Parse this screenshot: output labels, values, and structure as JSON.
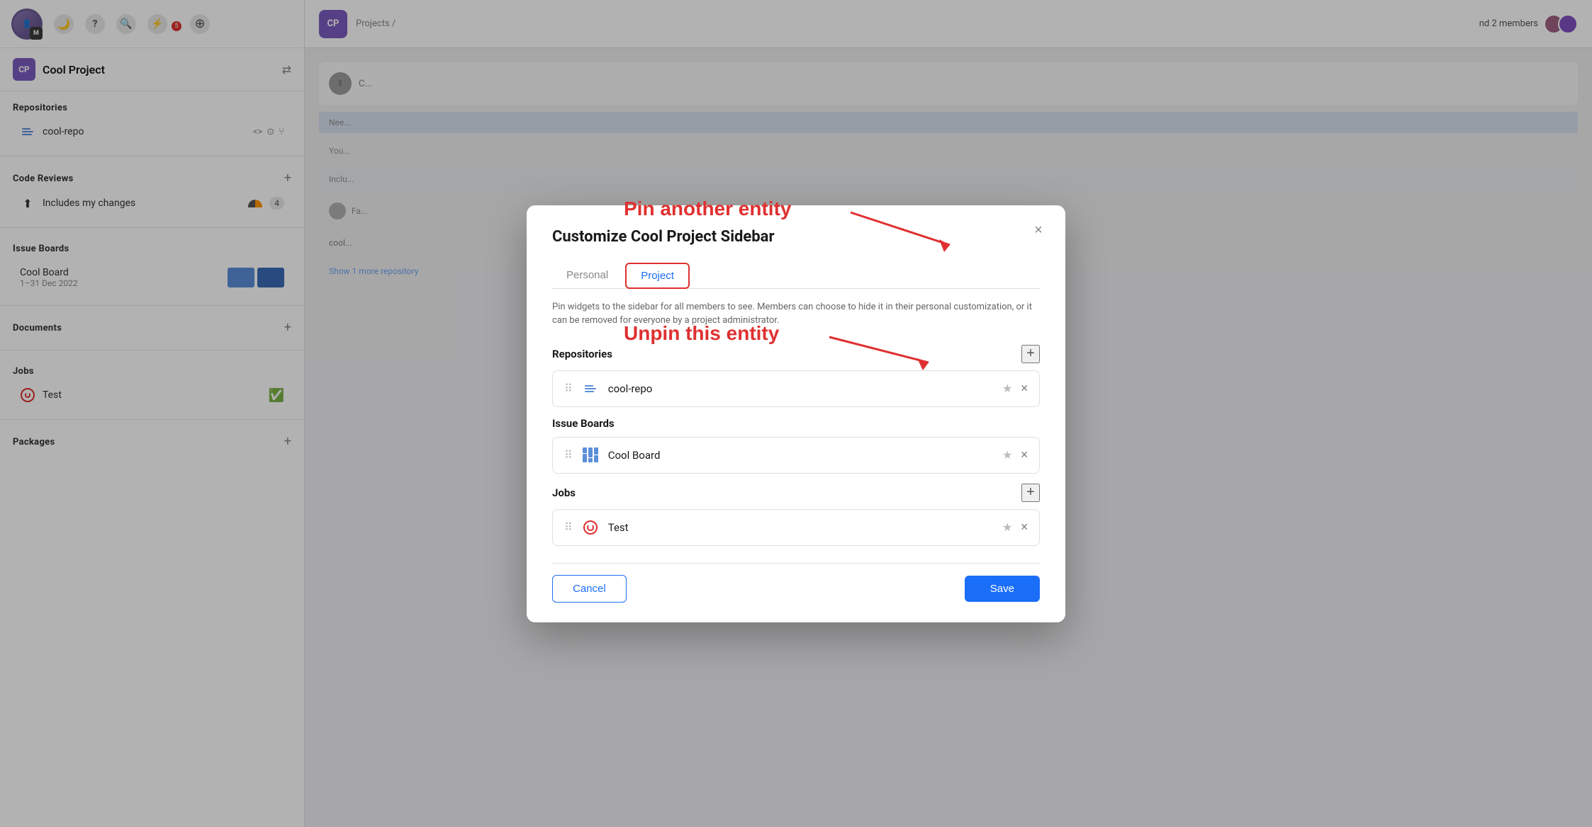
{
  "app": {
    "title": "Cool Project"
  },
  "sidebar": {
    "project_avatar": "CP",
    "project_name": "Cool Project",
    "sections": {
      "repositories": {
        "title": "Repositories",
        "items": [
          {
            "label": "cool-repo"
          }
        ]
      },
      "code_reviews": {
        "title": "Code Reviews",
        "items": [
          {
            "label": "Includes my changes",
            "badge": "4"
          }
        ]
      },
      "issue_boards": {
        "title": "Issue Boards",
        "items": [
          {
            "label": "Cool Board",
            "date": "1–31 Dec 2022"
          }
        ]
      },
      "documents": {
        "title": "Documents"
      },
      "jobs": {
        "title": "Jobs",
        "items": [
          {
            "label": "Test"
          }
        ]
      },
      "packages": {
        "title": "Packages"
      }
    }
  },
  "main": {
    "breadcrumb": "Projects /",
    "members_label": "nd 2 members"
  },
  "modal": {
    "title": "Customize Cool Project Sidebar",
    "close_label": "×",
    "tabs": [
      {
        "label": "Personal",
        "active": false
      },
      {
        "label": "Project",
        "active": true
      }
    ],
    "description": "Pin widgets to the sidebar for all members to see. Members can choose to hide it in their personal customization, or it can be removed for everyone by a project administrator.",
    "sections": {
      "repositories": {
        "label": "Repositories",
        "add_label": "+",
        "items": [
          {
            "name": "cool-repo"
          }
        ]
      },
      "issue_boards": {
        "label": "Issue Boards",
        "items": [
          {
            "name": "Cool Board"
          }
        ]
      },
      "jobs": {
        "label": "Jobs",
        "add_label": "+",
        "items": [
          {
            "name": "Test"
          }
        ]
      }
    },
    "footer": {
      "cancel_label": "Cancel",
      "save_label": "Save"
    }
  },
  "annotations": {
    "pin_label": "Pin another entity",
    "unpin_label": "Unpin this entity"
  },
  "colors": {
    "accent_blue": "#1a6ef7",
    "accent_red": "#e03030",
    "board_bar1": "#5b8fd9",
    "board_bar2": "#3a6bb5",
    "project_purple": "#7c5cbf"
  }
}
